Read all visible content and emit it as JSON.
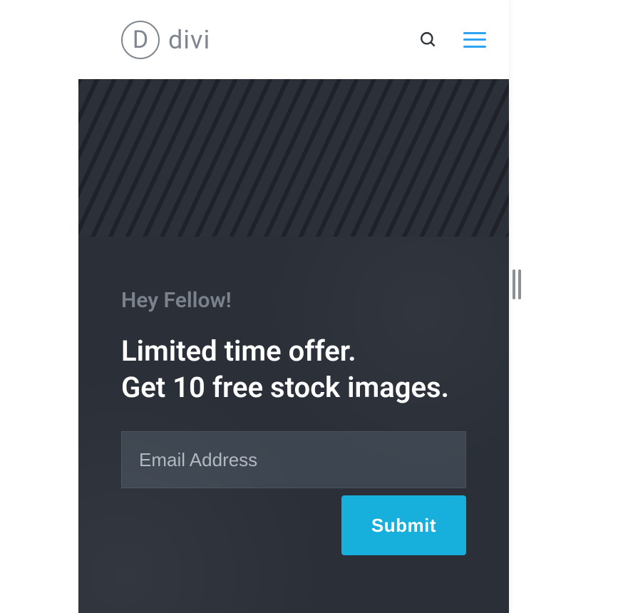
{
  "header": {
    "logo_letter": "D",
    "logo_text": "divi"
  },
  "offer": {
    "eyebrow": "Hey Fellow!",
    "title_line1": "Limited time offer.",
    "title_line2": "Get 10 free stock images.",
    "email_placeholder": "Email Address",
    "submit_label": "Submit"
  },
  "colors": {
    "accent": "#2ea3f2",
    "submit": "#17b0dc",
    "dark_bg": "#282c35",
    "offer_bg": "#2a2f38",
    "input_bg": "#3d4550"
  }
}
